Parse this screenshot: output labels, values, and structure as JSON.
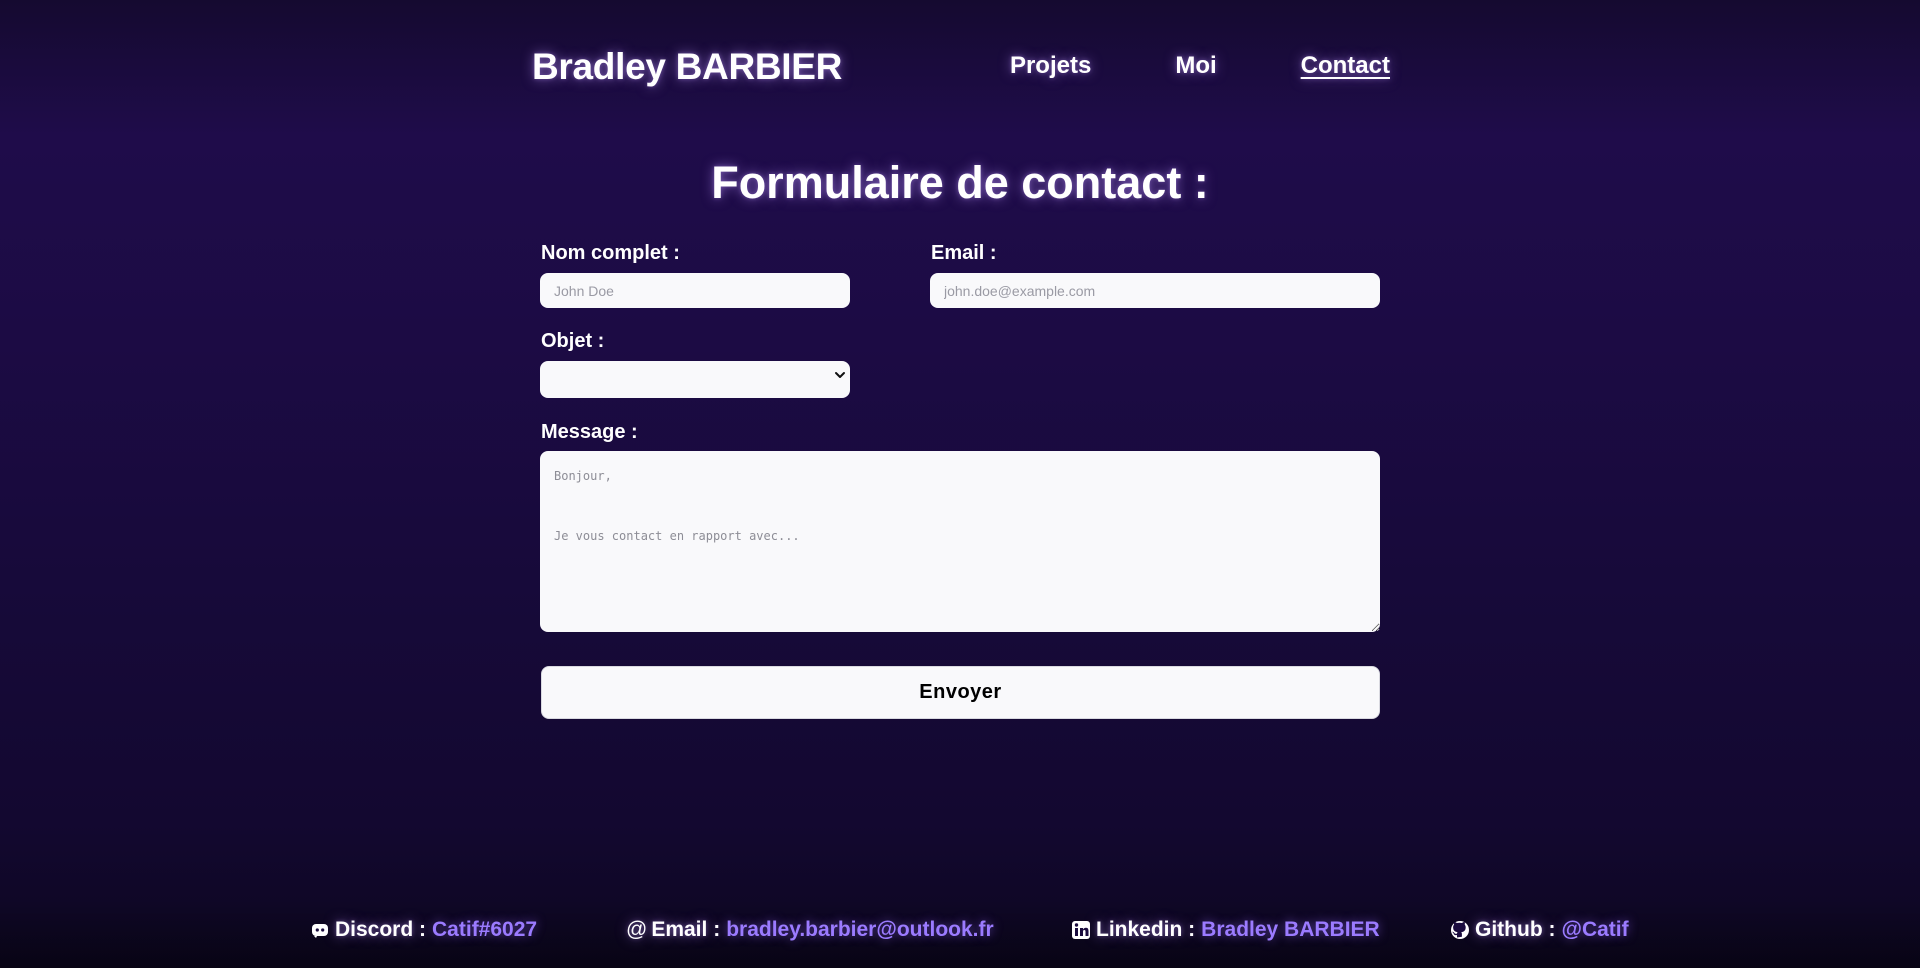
{
  "header": {
    "brand": "Bradley BARBIER",
    "nav": [
      {
        "label": "Projets",
        "active": false
      },
      {
        "label": "Moi",
        "active": false
      },
      {
        "label": "Contact",
        "active": true
      }
    ]
  },
  "form": {
    "title": "Formulaire de contact :",
    "name": {
      "label": "Nom complet :",
      "placeholder": "John Doe",
      "value": ""
    },
    "email": {
      "label": "Email :",
      "placeholder": "john.doe@example.com",
      "value": ""
    },
    "subject": {
      "label": "Objet :",
      "selected": ""
    },
    "message": {
      "label": "Message :",
      "placeholder": "Bonjour,\n\nJe vous contact en rapport avec...",
      "value": ""
    },
    "submit_label": "Envoyer"
  },
  "footer": {
    "discord": {
      "icon": "discord-icon",
      "label": "Discord :",
      "value": "Catif#6027"
    },
    "email": {
      "icon": "at-icon",
      "label": "Email :",
      "value": "bradley.barbier@outlook.fr"
    },
    "linkedin": {
      "icon": "linkedin-icon",
      "label": "Linkedin :",
      "value": "Bradley BARBIER"
    },
    "github": {
      "icon": "github-icon",
      "label": "Github :",
      "value": "@Catif"
    }
  },
  "colors": {
    "background_top": "#150a30",
    "background_mid": "#1f0c4a",
    "background_bottom": "#0c061f",
    "accent_link": "#9b7bff",
    "field_background": "#f9f9fb",
    "text": "#ffffff"
  }
}
